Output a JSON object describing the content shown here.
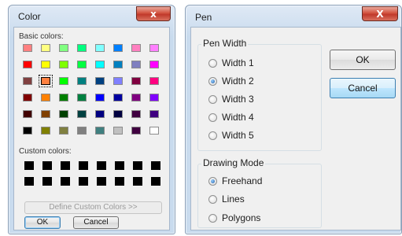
{
  "color_dialog": {
    "title": "Color",
    "close_label": "x",
    "basic_colors_label": "Basic colors:",
    "basic_colors": [
      [
        "#ff8080",
        "#ffff80",
        "#80ff80",
        "#00ff80",
        "#80ffff",
        "#0080ff",
        "#ff80c0",
        "#ff80ff"
      ],
      [
        "#ff0000",
        "#ffff00",
        "#80ff00",
        "#00ff40",
        "#00ffff",
        "#0080c0",
        "#8080c0",
        "#ff00ff"
      ],
      [
        "#804040",
        "#ff8040",
        "#00ff00",
        "#008080",
        "#004080",
        "#8080ff",
        "#800040",
        "#ff0080"
      ],
      [
        "#800000",
        "#ff8000",
        "#008000",
        "#008040",
        "#0000ff",
        "#0000a0",
        "#800080",
        "#8000ff"
      ],
      [
        "#400000",
        "#804000",
        "#004000",
        "#004040",
        "#000080",
        "#000040",
        "#400040",
        "#400080"
      ],
      [
        "#000000",
        "#808000",
        "#808040",
        "#808080",
        "#408080",
        "#c0c0c0",
        "#400040",
        "#ffffff"
      ]
    ],
    "selected_swatch": "r2c1",
    "custom_colors_label": "Custom colors:",
    "custom_colors": [
      "#000000",
      "#000000",
      "#000000",
      "#000000",
      "#000000",
      "#000000",
      "#000000",
      "#000000",
      "#000000",
      "#000000",
      "#000000",
      "#000000",
      "#000000",
      "#000000",
      "#000000",
      "#000000"
    ],
    "define_button": "Define Custom Colors >>",
    "ok_button": "OK",
    "cancel_button": "Cancel"
  },
  "pen_dialog": {
    "title": "Pen",
    "close_label": "X",
    "pen_width_group": "Pen Width",
    "widths": [
      {
        "label": "Width 1",
        "checked": false
      },
      {
        "label": "Width 2",
        "checked": true
      },
      {
        "label": "Width 3",
        "checked": false
      },
      {
        "label": "Width 4",
        "checked": false
      },
      {
        "label": "Width 5",
        "checked": false
      }
    ],
    "drawing_mode_group": "Drawing Mode",
    "modes": [
      {
        "label": "Freehand",
        "checked": true
      },
      {
        "label": "Lines",
        "checked": false
      },
      {
        "label": "Polygons",
        "checked": false
      }
    ],
    "ok_button": "OK",
    "cancel_button": "Cancel"
  }
}
